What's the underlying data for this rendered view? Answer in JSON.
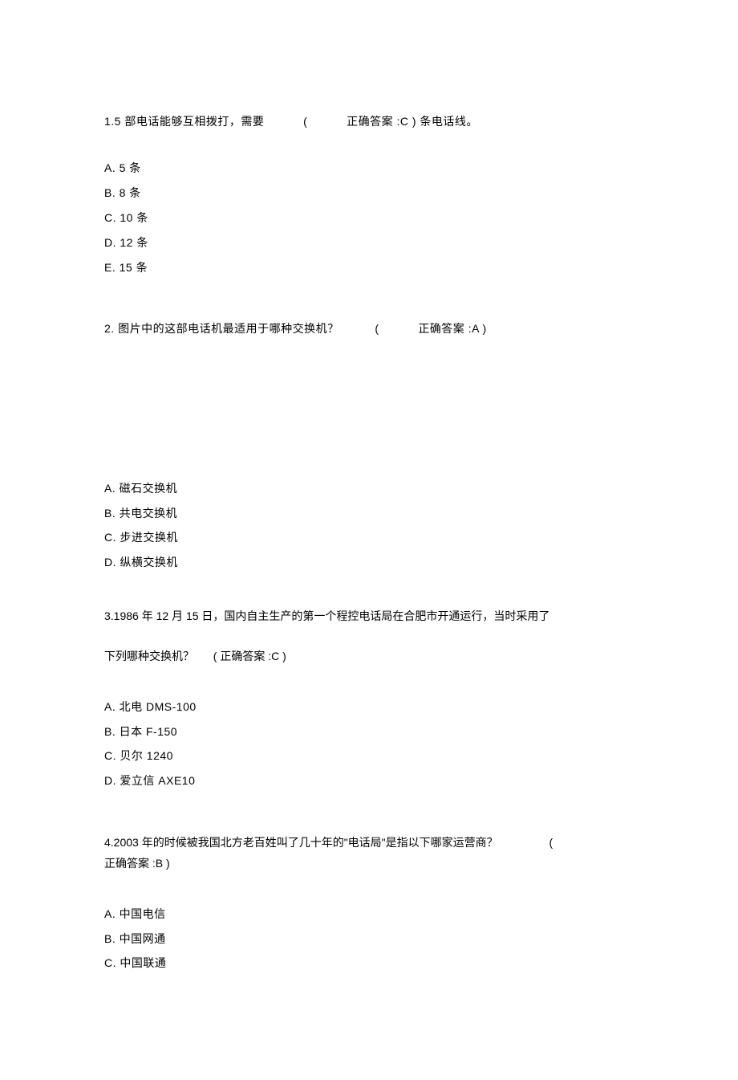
{
  "q1": {
    "stem_a": "1.5 部电话能够互相拨打，需要",
    "stem_b": "(",
    "stem_c": "正确答案 :C )  条电话线。",
    "opts": {
      "a": "A. 5  条",
      "b": "B. 8  条",
      "c": "C. 10  条",
      "d": "D. 12  条",
      "e": "E. 15  条"
    }
  },
  "q2": {
    "stem_a": "2. 图片中的这部电话机最适用于哪种交换机？",
    "stem_b": "(",
    "stem_c": "正确答案 :A )",
    "opts": {
      "a": "A.  磁石交换机",
      "b": "B.  共电交换机",
      "c": "C.  步进交换机",
      "d": "D.  纵横交换机"
    }
  },
  "q3": {
    "stem_line1": "3.1986 年 12 月 15 日，国内自主生产的第一个程控电话局在合肥市开通运行，当时采用了",
    "stem_line2_a": "下列哪种交换机？",
    "stem_line2_b": "(",
    "stem_line2_c": "正确答案 :C )",
    "opts": {
      "a": "A.  北电  DMS-100",
      "b": "B.  日本  F-150",
      "c": "C.  贝尔  1240",
      "d": "D.  爱立信  AXE10"
    }
  },
  "q4": {
    "stem_a": "4.2003 年的时候被我国北方老百姓叫了几十年的\"电话局\"是指以下哪家运营商？",
    "stem_b": "(",
    "stem_line2": "正确答案 :B )",
    "opts": {
      "a": "A.  中国电信",
      "b": "B.  中国网通",
      "c": "C.  中国联通"
    }
  }
}
